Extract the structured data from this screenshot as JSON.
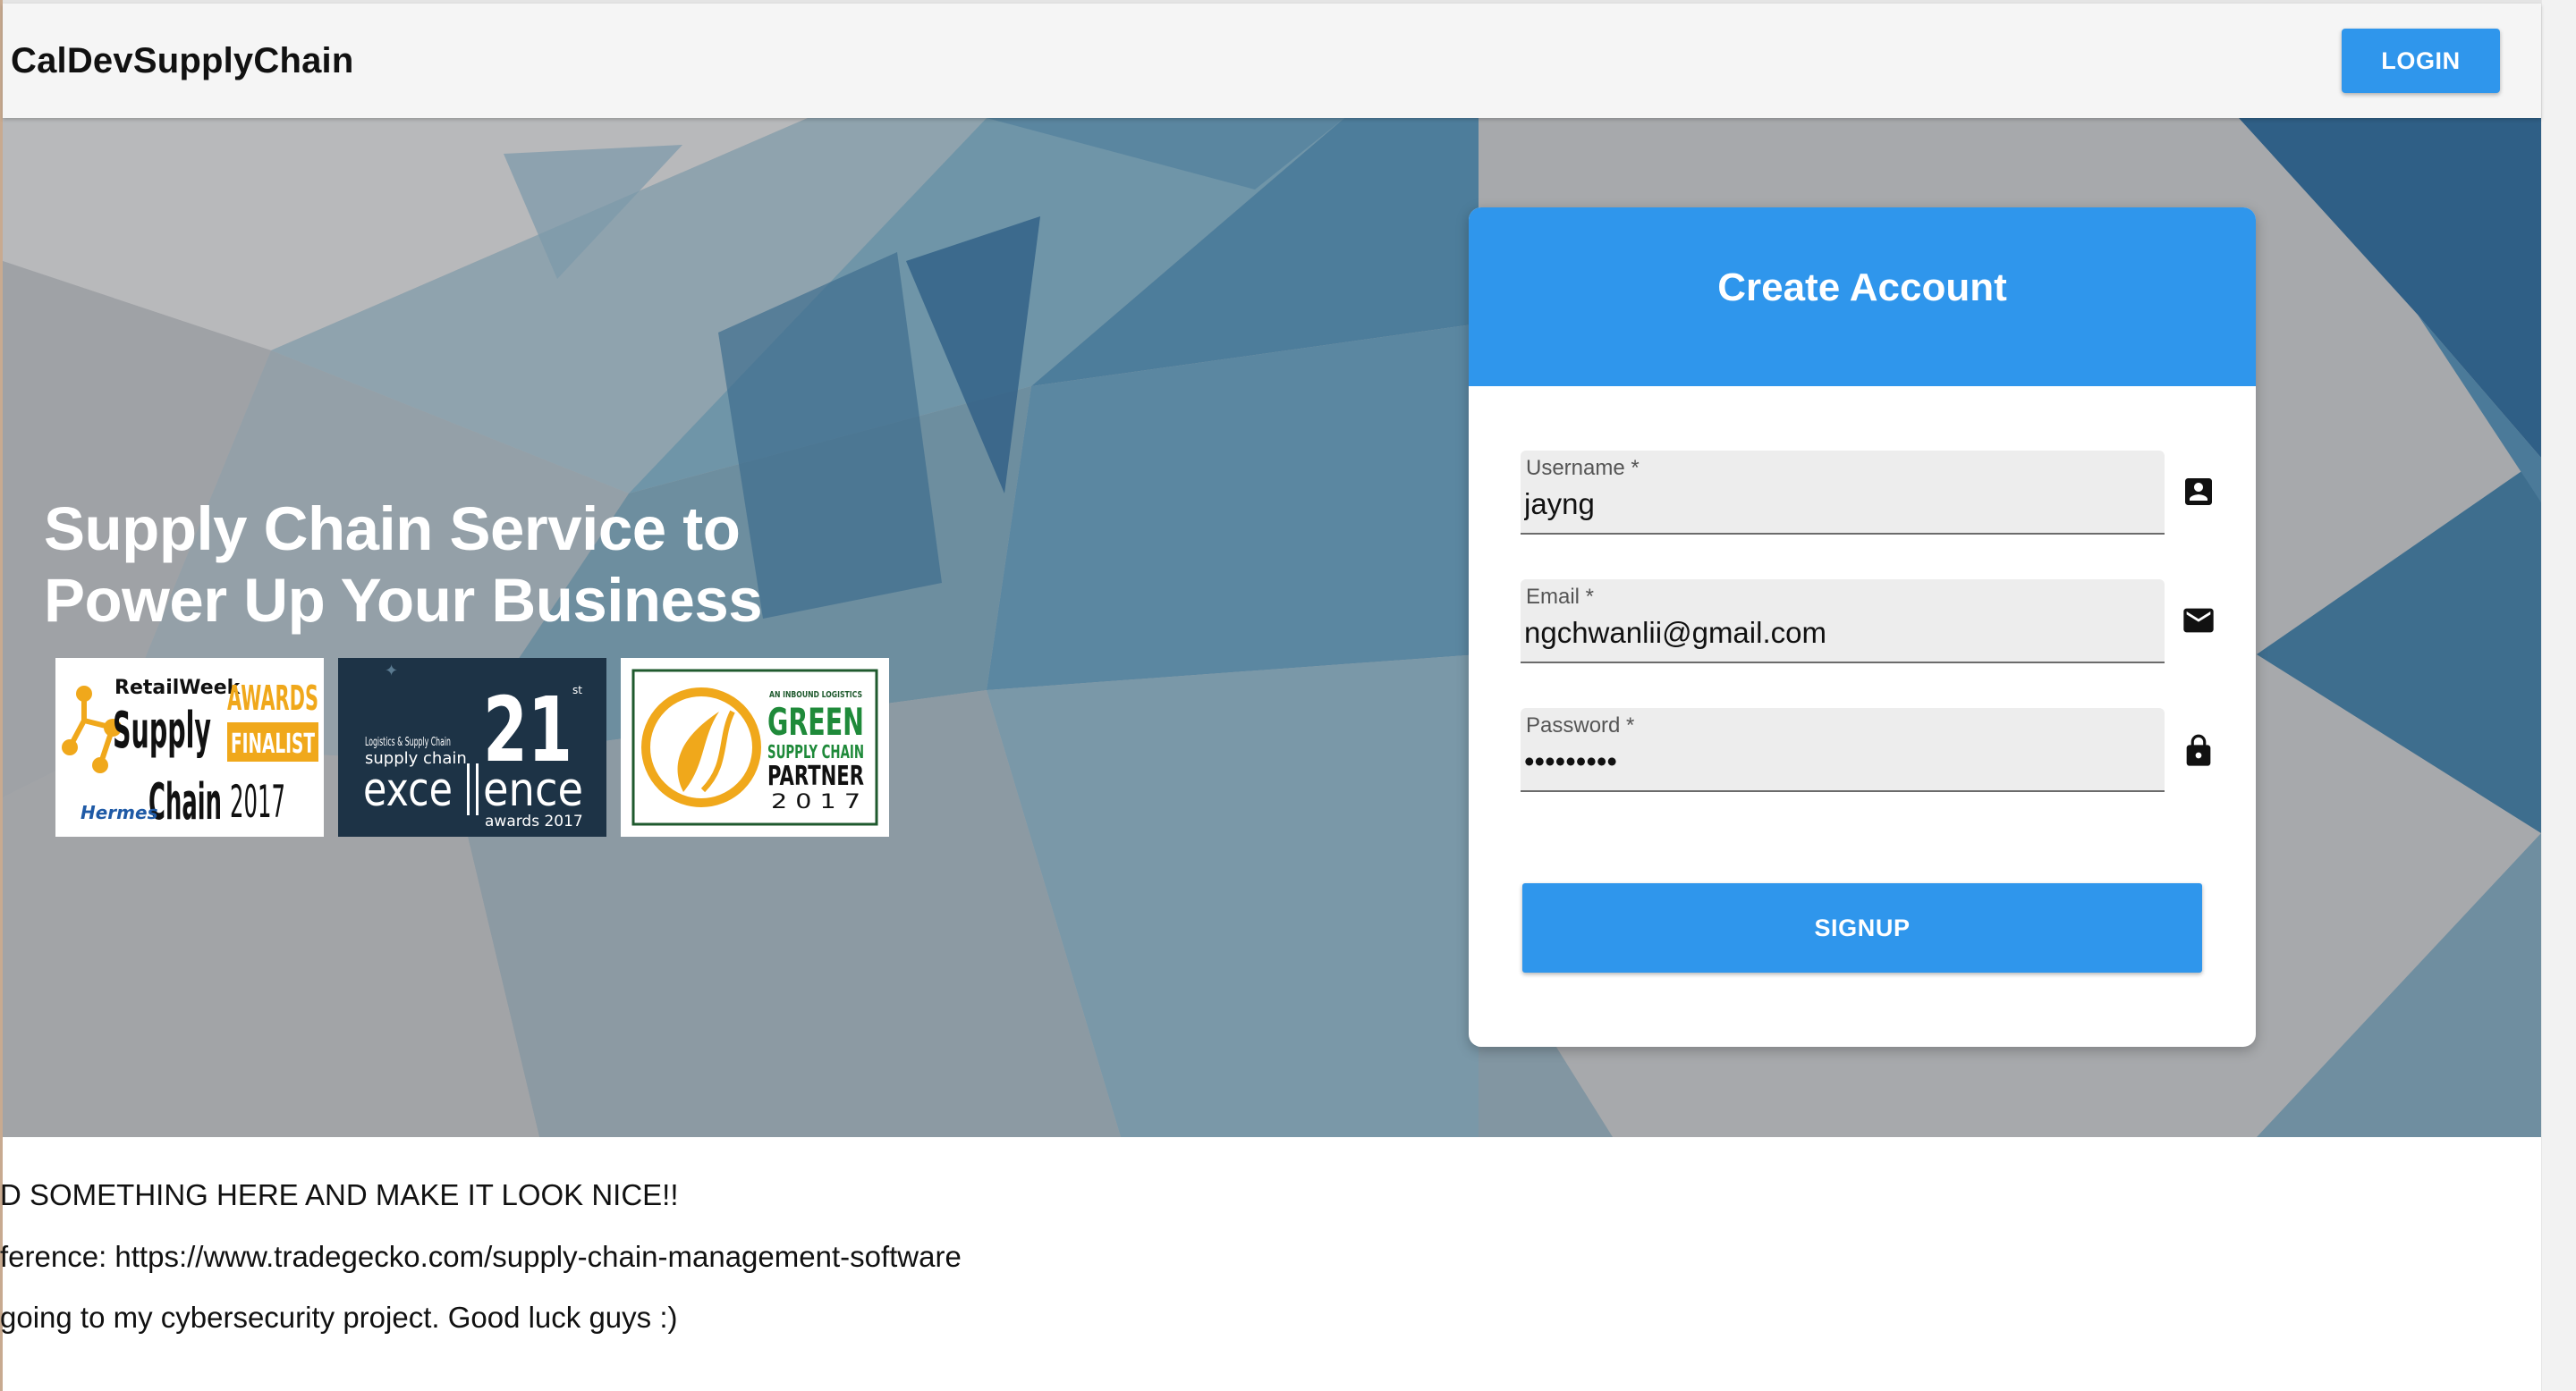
{
  "app": {
    "brand": "CalDevSupplyChain",
    "login_label": "LOGIN"
  },
  "hero": {
    "tagline_line1": "Supply Chain Service to",
    "tagline_line2": "Power Up Your Business",
    "awards": [
      {
        "name": "RetailWeek Supply Chain Awards Finalist 2017",
        "text": {
          "brand": "RetailWeek",
          "supply": "Supply",
          "chain": "Chain",
          "awards": "AWARDS",
          "finalist": "FINALIST",
          "year": "2017",
          "sponsor": "Hermes"
        }
      },
      {
        "name": "Logistics & Supply Chain supply chain excellence awards 2017",
        "text": {
          "publisher": "Logistics & Supply Chain",
          "subtitle": "supply chain",
          "number": "21",
          "suffix": "st",
          "word_a": "exce",
          "word_b": "ence",
          "awards": "awards 2017"
        }
      },
      {
        "name": "Inbound Logistics Green Supply Chain Partner 2017",
        "text": {
          "top": "AN INBOUND LOGISTICS",
          "green": "GREEN",
          "supply_chain": "SUPPLY CHAIN",
          "partner": "PARTNER",
          "year": "2 0 1 7"
        }
      }
    ]
  },
  "form": {
    "title": "Create Account",
    "fields": [
      {
        "label": "Username *",
        "value": "jayng",
        "icon": "account-box-icon"
      },
      {
        "label": "Email *",
        "value": "ngchwanlii@gmail.com",
        "icon": "email-icon"
      },
      {
        "label": "Password *",
        "value": "asdfghjkl",
        "icon": "lock-icon"
      }
    ],
    "submit_label": "SIGNUP"
  },
  "footer": {
    "lines": [
      "D SOMETHING HERE AND MAKE IT LOOK NICE!!",
      "ference: https://www.tradegecko.com/supply-chain-management-software",
      " going to my cybersecurity project. Good luck guys :)"
    ]
  },
  "colors": {
    "primary": "#2f96ec",
    "appbar": "#f5f5f5",
    "hero_gray": "#a5a8ab",
    "hero_blue": "#2f5f86"
  }
}
